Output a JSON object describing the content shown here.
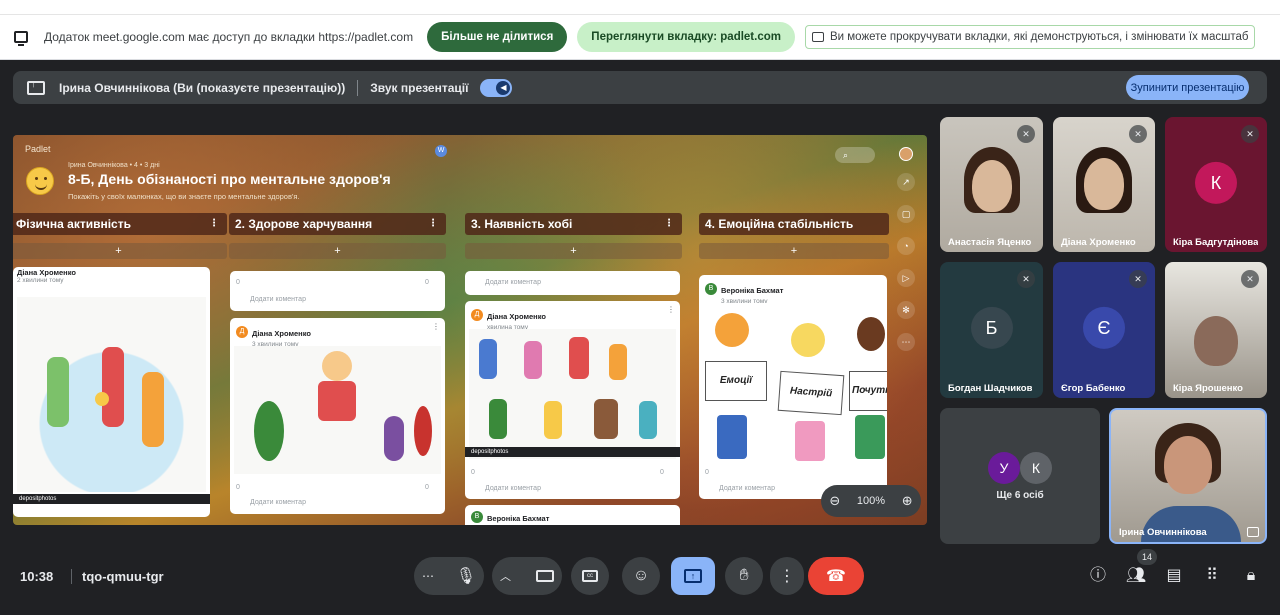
{
  "share_bar": {
    "access_text": "Додаток meet.google.com має доступ до вкладки https://padlet.com",
    "stop_sharing": "Більше не ділитися",
    "view_tab": "Переглянути вкладку: padlet.com",
    "info": "Ви можете прокручувати вкладки, які демонструються, і змінювати їх масштаб"
  },
  "presentation_bar": {
    "presenter": "Ірина Овчиннікова (Ви (показуєте презентацію))",
    "sound_label": "Звук презентації",
    "stop_button": "Зупинити презентацію"
  },
  "padlet": {
    "brand": "Padlet",
    "meta": "Ірина Овчиннікова • 4 • 3 дні",
    "title": "8-Б, День обізнаності про ментальне здоров'я",
    "subtitle": "Покажіть у своїх малюнках, що ви знаєте про ментальне здоров'я.",
    "columns": [
      {
        "title": "Фізична активність"
      },
      {
        "title": "2. Здорове харчування"
      },
      {
        "title": "3. Наявність хобі"
      },
      {
        "title": "4. Емоційна стабільність"
      }
    ],
    "add_symbol": "+",
    "cards": {
      "c1_author": "Діана Хроменко",
      "c1_time": "2 хвилини тому",
      "c2_comment_placeholder": "Додати коментар",
      "c2_count": "0",
      "c3_author": "Діана Хроменко",
      "c3_time": "3 хвилини тому",
      "c4_author": "Діана Хроменко",
      "c4_time": "хвилина тому",
      "c5_author": "Вероніка Бахмат",
      "c5_time": "3 хвилини тому",
      "c6_author": "Вероніка Бахмат",
      "watermark": "depositphotos",
      "sign_1": "Емоції",
      "sign_2": "Настрій",
      "sign_3": "Почуття"
    },
    "zoom": "100%"
  },
  "participants": [
    {
      "name": "Анастасія Яценко",
      "initial": "",
      "muted": true
    },
    {
      "name": "Діана Хроменко",
      "initial": "",
      "muted": true
    },
    {
      "name": "Кіра Бадгутдінова",
      "initial": "К",
      "muted": true,
      "color": "#c2185b"
    },
    {
      "name": "Богдан Шадчиков",
      "initial": "Б",
      "muted": true,
      "color": "#37474f"
    },
    {
      "name": "Єгор Бабенко",
      "initial": "Є",
      "muted": true,
      "color": "#3949ab"
    },
    {
      "name": "Кіра Ярошенко",
      "initial": "",
      "muted": true
    }
  ],
  "more_tile": {
    "avatars": [
      "У",
      "К"
    ],
    "label": "Ще 6 осіб"
  },
  "self_tile": {
    "name": "Ірина Овчиннікова"
  },
  "bottom_bar": {
    "time": "10:38",
    "meeting_code": "tqo-qmuu-tgr",
    "people_count": "14"
  }
}
